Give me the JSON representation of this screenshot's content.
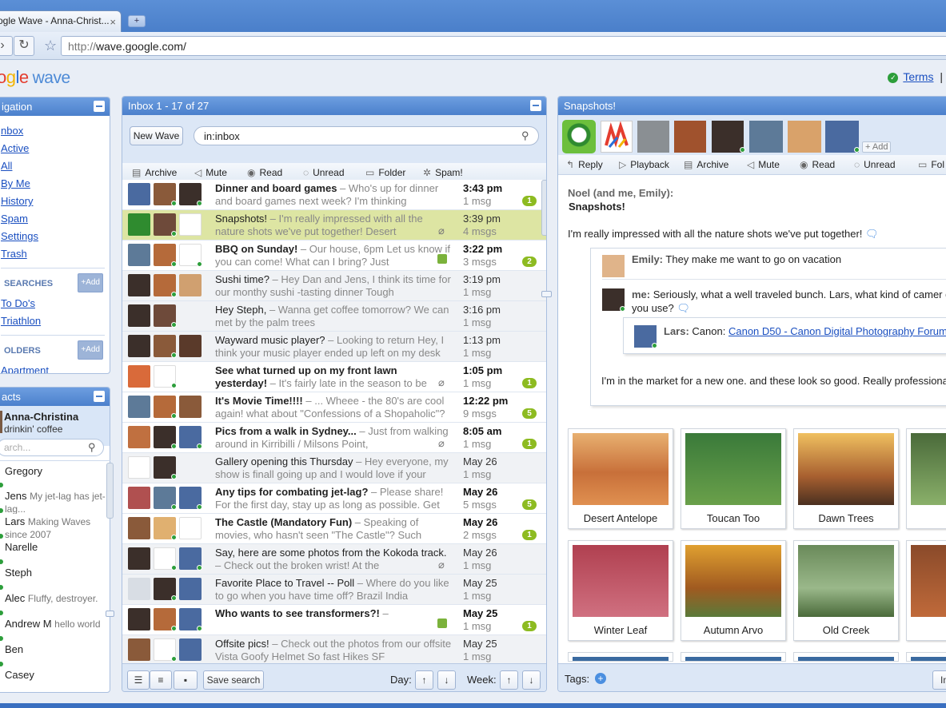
{
  "browser": {
    "tab_title": "ogle Wave - Anna-Christ...",
    "tab_close": "×",
    "new_tab": "+",
    "url_prefix": "http://",
    "url_host": "wave.google.com/"
  },
  "header": {
    "logo_letters": [
      "o",
      "g",
      "l",
      "e"
    ],
    "logo_wave": "wave",
    "terms": "Terms",
    "terms_sep": "|"
  },
  "navigation": {
    "title": "igation",
    "links": [
      "nbox",
      "Active",
      "All",
      "By Me",
      "History",
      "Spam",
      "Settings",
      "Trash"
    ],
    "searches_title": "SEARCHES",
    "searches": [
      "To Do's",
      "Triathlon"
    ],
    "folders_title": "OLDERS",
    "folders": [
      "Apartment"
    ],
    "add_label": "Add"
  },
  "contacts": {
    "title": "acts",
    "me_name": "Anna-Christina",
    "me_status": "drinkin' coffee",
    "search_placeholder": "arch...",
    "list": [
      {
        "name": "Gregory",
        "status": ""
      },
      {
        "name": "Jens",
        "status": "My jet-lag has jet-lag..."
      },
      {
        "name": "Lars",
        "status": "Making Waves since 2007"
      },
      {
        "name": "Narelle",
        "status": ""
      },
      {
        "name": "Steph",
        "status": ""
      },
      {
        "name": "Alec",
        "status": "Fluffy, destroyer."
      },
      {
        "name": "Andrew M",
        "status": "hello world"
      },
      {
        "name": "Ben",
        "status": ""
      },
      {
        "name": "Casey",
        "status": ""
      }
    ]
  },
  "inbox": {
    "title": "Inbox 1 - 17 of 27",
    "new_wave": "New Wave",
    "search_value": "in:inbox",
    "toolbar": [
      "Archive",
      "Mute",
      "Read",
      "Unread",
      "Folder",
      "Spam!"
    ],
    "rows": [
      {
        "title": "Dinner and board games",
        "snippet": " – Who's up for dinner and board games next week? I'm thinking",
        "time": "3:43 pm",
        "count": "1 msg",
        "badge": "1",
        "unread": true,
        "sel": false,
        "att": ""
      },
      {
        "title": "Snapshots!",
        "snippet": " – I'm really impressed with all the nature shots we've put together! Desert",
        "time": "3:39 pm",
        "count": "4 msgs",
        "badge": "",
        "unread": false,
        "sel": true,
        "att": "clip"
      },
      {
        "title": "BBQ on Sunday!",
        "snippet": " – Our house, 6pm Let us know if you can come! What can I bring? Just",
        "time": "3:22 pm",
        "count": "3 msgs",
        "badge": "2",
        "unread": true,
        "sel": false,
        "att": "puzzle"
      },
      {
        "title": "Sushi time?",
        "snippet": " – Hey Dan and Jens, I think its time for our monthy sushi -tasting dinner Tough",
        "time": "3:19 pm",
        "count": "1 msg",
        "badge": "",
        "unread": false,
        "sel": false,
        "att": ""
      },
      {
        "title": "Hey Steph,",
        "snippet": " – Wanna get coffee tomorrow? We can met by the palm trees",
        "time": "3:16 pm",
        "count": "1 msg",
        "badge": "",
        "unread": false,
        "sel": false,
        "att": ""
      },
      {
        "title": "Wayward music player?",
        "snippet": " – Looking to return Hey, I think your music player ended up left on my desk",
        "time": "1:13 pm",
        "count": "1 msg",
        "badge": "",
        "unread": false,
        "sel": false,
        "att": ""
      },
      {
        "title": "See what turned up on my front lawn yesterday!",
        "snippet": " – It's fairly late in the season to be",
        "time": "1:05 pm",
        "count": "1 msg",
        "badge": "1",
        "unread": true,
        "sel": false,
        "att": "clip"
      },
      {
        "title": "It's Movie Time!!!!",
        "snippet": " – ... Wheee - the 80's are cool again! what about \"Confessions of a Shopaholic\"?",
        "time": "12:22 pm",
        "count": "9 msgs",
        "badge": "5",
        "unread": true,
        "sel": false,
        "att": ""
      },
      {
        "title": "Pics from a walk in Sydney...",
        "snippet": " – Just from walking around in Kirribilli / Milsons Point,",
        "time": "8:05 am",
        "count": "1 msg",
        "badge": "1",
        "unread": true,
        "sel": false,
        "att": "clip"
      },
      {
        "title": "Gallery opening this Thursday",
        "snippet": " – Hey everyone, my show is finall going up and I would love if your",
        "time": "May 26",
        "count": "1 msg",
        "badge": "",
        "unread": false,
        "sel": false,
        "att": ""
      },
      {
        "title": "Any tips for combating jet-lag?",
        "snippet": " – Please share! For the first day, stay up as long as possible. Get",
        "time": "May 26",
        "count": "5 msgs",
        "badge": "5",
        "unread": true,
        "sel": false,
        "att": ""
      },
      {
        "title": "The Castle (Mandatory Fun)",
        "snippet": " – Speaking of movies, who hasn't seen \"The Castle\"? Such",
        "time": "May 26",
        "count": "2 msgs",
        "badge": "1",
        "unread": true,
        "sel": false,
        "att": ""
      },
      {
        "title": "Say, here are some photos from the Kokoda track.",
        "snippet": " – Check out the broken wrist! At the",
        "time": "May 26",
        "count": "1 msg",
        "badge": "",
        "unread": false,
        "sel": false,
        "att": "clip"
      },
      {
        "title": "Favorite Place to Travel -- Poll",
        "snippet": " – Where do you like to go when you have time off? Brazil India",
        "time": "May 25",
        "count": "1 msg",
        "badge": "",
        "unread": false,
        "sel": false,
        "att": ""
      },
      {
        "title": "Who wants to see transformers?!",
        "snippet": " –",
        "time": "May 25",
        "count": "1 msg",
        "badge": "1",
        "unread": true,
        "sel": false,
        "att": "puzzle"
      },
      {
        "title": "Offsite pics!",
        "snippet": " – Check out the photos from our offsite Vista Goofy Helmet So fast Hikes SF",
        "time": "May 25",
        "count": "1 msg",
        "badge": "",
        "unread": false,
        "sel": false,
        "att": ""
      }
    ],
    "save_search": "Save search",
    "day_label": "Day:",
    "week_label": "Week:"
  },
  "wave": {
    "title": "Snapshots!",
    "add_label": "Add",
    "toolbar": [
      "Reply",
      "Playback",
      "Archive",
      "Mute",
      "Read",
      "Unread",
      "Fol"
    ],
    "authors": "Noel (and me, Emily):",
    "blip_title": "Snapshots!",
    "blip_text": "I'm really impressed with all the nature shots we've put together!",
    "replies": [
      {
        "name": "Emily:",
        "text": "They make me want to go on vacation"
      },
      {
        "name": "me:",
        "text": "Seriously, what a well traveled bunch. Lars, what kind of camer did you use?"
      },
      {
        "name": "Lars:",
        "text": "Canon:",
        "link": "Canon D50 - Canon Digital Photography Forum"
      }
    ],
    "closing_text": "I'm in the market for a new one. and these look so good. Really professiona",
    "photos": [
      "Desert Antelope",
      "Toucan Too",
      "Dawn Trees",
      "W",
      "Winter Leaf",
      "Autumn Arvo",
      "Old Creek",
      "D"
    ],
    "tags_label": "Tags:",
    "footer_btn": "Ima"
  },
  "colors": {
    "accent": "#4b80cc",
    "selected_row": "#dde5a3",
    "badge": "#8dbb21",
    "online": "#2d9e3b",
    "link": "#1a4fc0"
  }
}
